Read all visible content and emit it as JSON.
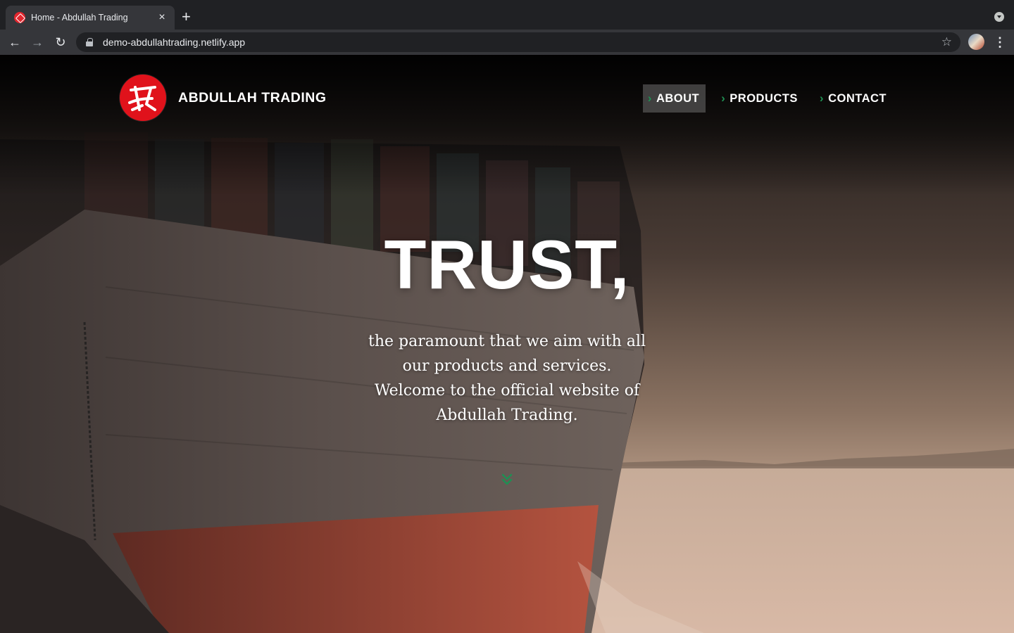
{
  "browser": {
    "tab_title": "Home - Abdullah Trading",
    "tab_close": "×",
    "new_tab": "+",
    "back": "←",
    "forward": "→",
    "reload": "↻",
    "url": "demo-abdullahtrading.netlify.app",
    "star": "☆",
    "menu": "⋮"
  },
  "site": {
    "brand_name": "ABDULLAH TRADING",
    "nav": [
      {
        "label": "ABOUT",
        "active": true
      },
      {
        "label": "PRODUCTS",
        "active": false
      },
      {
        "label": "CONTACT",
        "active": false
      }
    ],
    "nav_chevron": "›",
    "hero_title": "TRUST,",
    "hero_lines": [
      "the paramount that we aim with all",
      "our products and services.",
      "Welcome to the official website of",
      "Abdullah Trading."
    ],
    "accent_color": "#1f8f53",
    "logo_color": "#e0121b"
  }
}
